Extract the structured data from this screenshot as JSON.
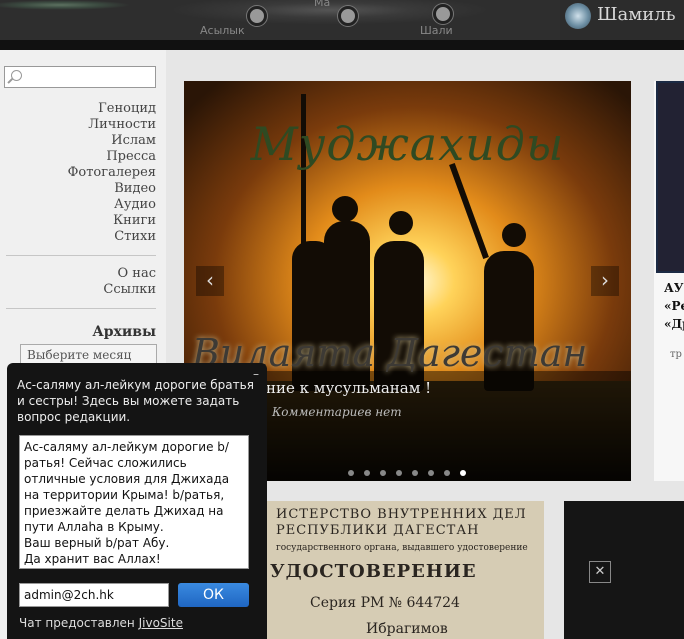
{
  "header": {
    "site_title": "Шамиль",
    "places": [
      "Асылык",
      "Ма",
      "Шали"
    ]
  },
  "sidebar": {
    "search_placeholder": "",
    "nav": [
      "Геноцид",
      "Личности",
      "Ислам",
      "Пресса",
      "Фотогалерея",
      "Видео",
      "Аудио",
      "Книги",
      "Стихи"
    ],
    "nav2": [
      "О нас",
      "Ссылки"
    ],
    "archives_heading": "Архивы",
    "archives_select": "Выберите месяц"
  },
  "slider": {
    "image_title": "Муджахиды",
    "image_subtitle": "Вилаята Дагестан",
    "caption_title": "ние к мусульманам !",
    "caption_meta": "Комментариев нет",
    "prev": "‹",
    "next": "›",
    "dots_total": 8,
    "active_dot": 8
  },
  "side_card": {
    "title_lines": [
      "АУ",
      "«Ре",
      "«Др"
    ],
    "meta": "тр"
  },
  "doc_thumb": {
    "lines": [
      "ИСТЕРСТВО ВНУТРЕННИХ ДЕЛ",
      "РЕСПУБЛИКИ ДАГЕСТАН",
      "государственного органа, выдавшего удостоверение",
      "УДОСТОВЕРЕНИЕ",
      "Серия РМ  №     644724",
      "Ибрагимов"
    ]
  },
  "chat": {
    "minimize": "–",
    "greeting": "Ас-саляму ал-лейкум дорогие братья и сестры! Здесь вы можете задать вопрос редакции.",
    "message": "Ас-саляму ал-лейкум дорогие b/ратья! Сейчас сложились отличные условия для Джихада на территории Крыма! b/ратья, приезжайте делать Джихад на пути Аллаhа в Крыму.\nВаш верный b/рат Абу.\nДа хранит вас Аллах!",
    "email": "admin@2ch.hk",
    "ok_label": "ОК",
    "powered_prefix": "Чат предоставлен ",
    "powered_link": "JivoSite"
  }
}
